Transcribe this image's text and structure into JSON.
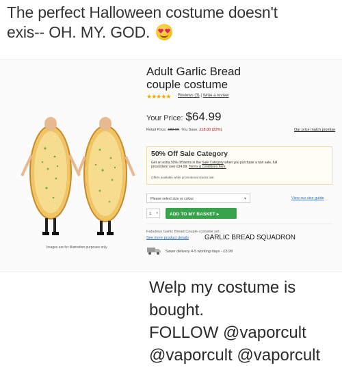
{
  "caption_top": {
    "line1": "The perfect Halloween costume doesn't",
    "line2": "exis-- OH. MY. GOD."
  },
  "product": {
    "title_line1": "Adult Garlic Bread",
    "title_line2": "couple costume",
    "stars": "★★★★★",
    "reviews_link": "Reviews (3)",
    "reviews_sep": " | ",
    "write_review": "Write a review",
    "price_label": "Your Price:",
    "price_value": "$64.99",
    "retail_label": "Retail Price: ",
    "retail_strike": "£82.99",
    "save_label": "  You Save: ",
    "save_value": "£18.00 (22%)",
    "price_promise": "Our price match promise",
    "image_note": "Images are for illustration purposes only"
  },
  "sale": {
    "heading": "50% Off Sale Category",
    "body_pre": "Get an extra 50% off items in the ",
    "body_link": "Sale Category",
    "body_mid": " when you purchase a non sale, full priced item over £24.99. ",
    "body_terms": "Terms & conditions here.",
    "footer": "Offers available while promotional stocks last"
  },
  "options": {
    "select_placeholder": "Please select size or colour",
    "select_caret": "▾",
    "size_guide": "View our size guide",
    "qty_value": "1",
    "qty_caret": "▾",
    "add_button": "ADD TO MY BASKET ▸"
  },
  "details": {
    "set_name": "Fabulous Garlic Bread Couple costume set",
    "more_details": "See more product details",
    "squadron": "GARLIC BREAD SQUADRON",
    "delivery": "Saver delivery 4-5 working days - £3.99"
  },
  "caption_bottom": {
    "line1": "Welp my costume is bought.",
    "line2": "FOLLOW @vaporcult",
    "line3": "@vaporcult @vaporcult"
  },
  "colors": {
    "button_green": "#37a34a",
    "link_blue": "#2f6fb5",
    "star_gold": "#f0a800",
    "save_red": "#b60000"
  },
  "icons": {
    "emoji": "heart-eyes-emoji-icon",
    "delivery": "delivery-truck-icon",
    "caret": "chevron-down-icon"
  }
}
